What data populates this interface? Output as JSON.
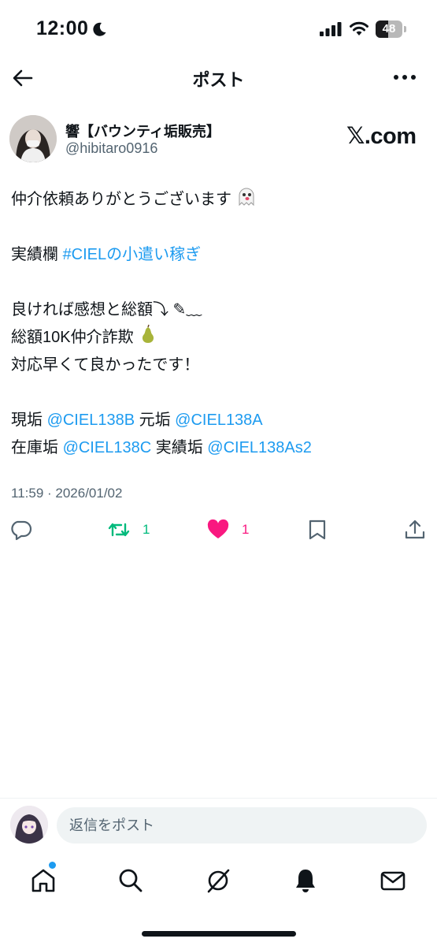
{
  "status_bar": {
    "time": "12:00",
    "battery": "48",
    "battery_level": 0.48
  },
  "header": {
    "title": "ポスト"
  },
  "author": {
    "name": "響【バウンティ垢販売】",
    "handle": "@hibitaro0916"
  },
  "watermark": "𝕏.com",
  "post": {
    "line1": "仲介依頼ありがとうございます",
    "line2_text": "実績欄 ",
    "line2_hashtag": "#CIELの小遣い稼ぎ",
    "line3": "良ければ感想と総額⤵︎ ✎﹏",
    "line4": "総額10K仲介詐欺",
    "line5": "対応早くて良かったです！",
    "line6_a": "現垢 ",
    "line6_b": "@CIEL138B",
    "line6_c": " 元垢 ",
    "line6_d": "@CIEL138A",
    "line7_a": "在庫垢 ",
    "line7_b": "@CIEL138C",
    "line7_c": " 実績垢 ",
    "line7_d": "@CIEL138As2"
  },
  "timestamp": "11:59 · 2026/01/02",
  "actions": {
    "retweet_count": "1",
    "like_count": "1"
  },
  "reply": {
    "placeholder": "返信をポスト"
  },
  "colors": {
    "link": "#1d9bf0",
    "retweet": "#00ba7c",
    "like": "#f91880"
  },
  "icons": [
    "back-arrow-icon",
    "more-icon",
    "reply-icon",
    "retweet-icon",
    "heart-icon",
    "bookmark-icon",
    "share-icon",
    "home-icon",
    "search-icon",
    "grok-icon",
    "bell-icon",
    "mail-icon"
  ]
}
